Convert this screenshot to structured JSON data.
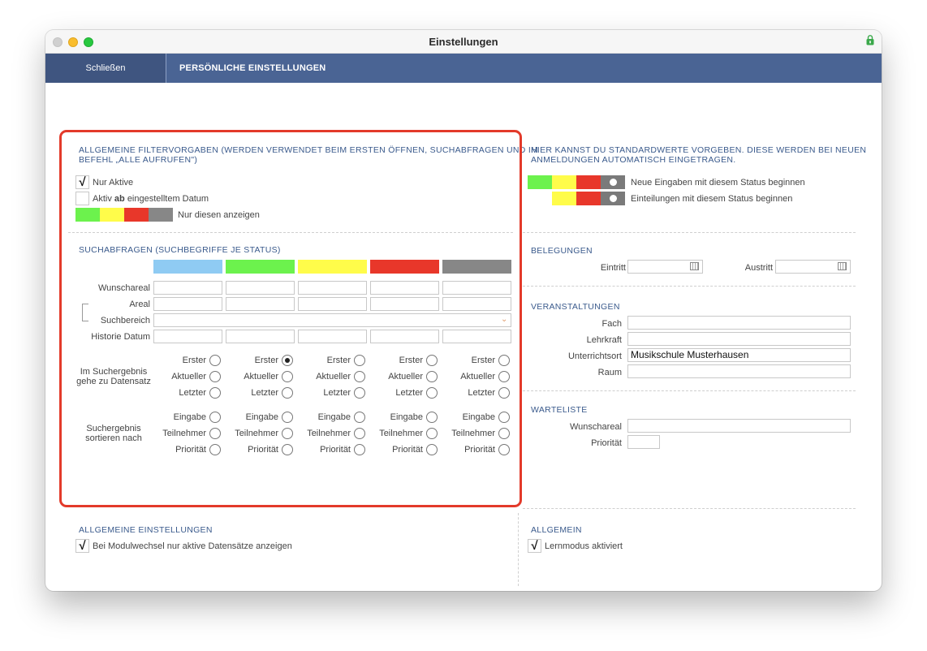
{
  "window": {
    "title": "Einstellungen"
  },
  "nav": {
    "close_label": "Schließen",
    "section_title": "PERSÖNLICHE EINSTELLUNGEN"
  },
  "filter": {
    "heading_line1": "ALLGEMEINE FILTERVORGABEN (WERDEN VERWENDET BEIM ERSTEN ÖFFNEN, SUCHABFRAGEN UND IM",
    "heading_line2": "BEFEHL „ALLE AUFRUFEN\")",
    "nur_aktive": {
      "label": "Nur Aktive",
      "checked": true
    },
    "aktiv_ab": {
      "prefix": "Aktiv",
      "bold": "ab",
      "suffix": "eingestelltem Datum",
      "checked": false
    },
    "nur_diesen": "Nur diesen anzeigen",
    "check_mark": "√"
  },
  "colors": {
    "green": "#6cf24d",
    "yellow": "#fffc4a",
    "red": "#e8372a",
    "gray": "#878787",
    "blue": "#8fcbf3",
    "accent": "#4a6494"
  },
  "suchabfragen": {
    "heading": "SUCHABFRAGEN (SUCHBEGRIFFE JE STATUS)",
    "status_colors": [
      "blue",
      "green",
      "yellow",
      "red",
      "gray"
    ],
    "rows": [
      "Wunschareal",
      "Areal",
      "Suchbereich",
      "Historie Datum"
    ],
    "goto_label_line1": "Im Suchergebnis",
    "goto_label_line2": "gehe zu Datensatz",
    "goto_options": [
      "Erster",
      "Aktueller",
      "Letzter"
    ],
    "goto_selected": [
      null,
      "Erster",
      null,
      null,
      null
    ],
    "sort_label_line1": "Suchergebnis",
    "sort_label_line2": "sortieren nach",
    "sort_options": [
      "Eingabe",
      "Teilnehmer",
      "Priorität"
    ]
  },
  "defaults": {
    "heading_line1": "HIER KANNST DU STANDARDWERTE VORGEBEN. DIESE WERDEN BEI NEUEN",
    "heading_line2": "ANMELDUNGEN AUTOMATISCH EINGETRAGEN.",
    "neue_eingaben": "Neue Eingaben mit diesem Status beginnen",
    "einteilungen": "Einteilungen mit diesem Status beginnen"
  },
  "belegungen": {
    "heading": "BELEGUNGEN",
    "eintritt": "Eintritt",
    "austritt": "Austritt"
  },
  "veranstaltungen": {
    "heading": "VERANSTALTUNGEN",
    "fach": "Fach",
    "lehrkraft": "Lehrkraft",
    "unterrichtsort": "Unterrichtsort",
    "unterrichtsort_value": "Musikschule Musterhausen",
    "raum": "Raum"
  },
  "warteliste": {
    "heading": "WARTELISTE",
    "wunschareal": "Wunschareal",
    "prioritaet": "Priorität"
  },
  "allgemeine_einstellungen": {
    "heading": "ALLGEMEINE EINSTELLUNGEN",
    "modulwechsel": "Bei Modulwechsel nur aktive Datensätze anzeigen",
    "checked": true
  },
  "allgemein": {
    "heading": "ALLGEMEIN",
    "lernmodus": "Lernmodus aktiviert",
    "checked": true
  }
}
